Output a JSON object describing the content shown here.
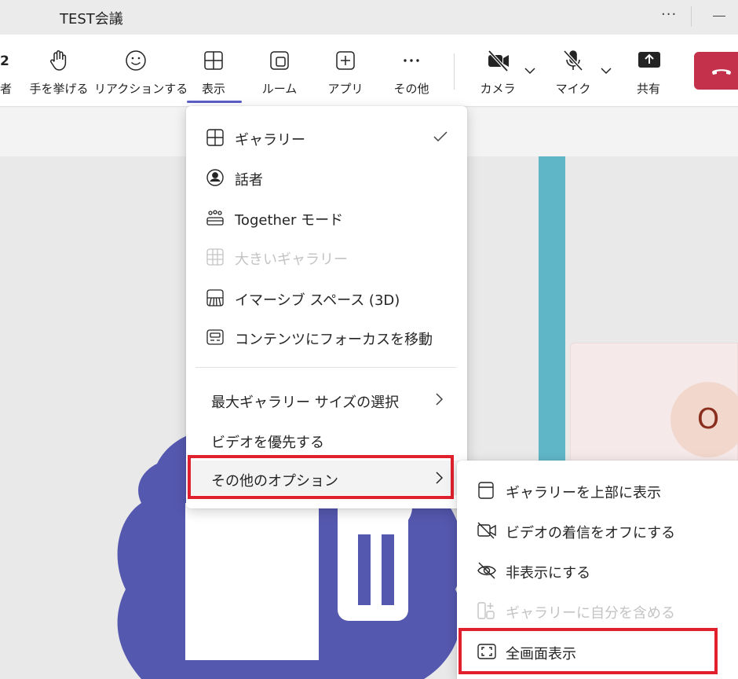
{
  "window": {
    "title": "TEST会議"
  },
  "toolbar": {
    "participants_count": "2",
    "participants_label": "者",
    "raise_hand": "手を挙げる",
    "reactions": "リアクションする",
    "view": "表示",
    "rooms": "ルーム",
    "apps": "アプリ",
    "more": "その他",
    "camera": "カメラ",
    "mic": "マイク",
    "share": "共有"
  },
  "view_menu": {
    "gallery": "ギャラリー",
    "speaker": "話者",
    "together": "Together モード",
    "large_gallery": "大きいギャラリー",
    "immersive": "イマーシブ スペース (3D)",
    "focus_content": "コンテンツにフォーカスを移動",
    "max_gallery_size": "最大ギャラリー サイズの選択",
    "prioritize_video": "ビデオを優先する",
    "more_options": "その他のオプション"
  },
  "options_submenu": {
    "gallery_on_top": "ギャラリーを上部に表示",
    "turn_off_incoming_video": "ビデオの着信をオフにする",
    "hide": "非表示にする",
    "include_self_in_gallery": "ギャラリーに自分を含める",
    "full_screen": "全画面表示"
  },
  "stage": {
    "avatar_initial": "O"
  },
  "colors": {
    "accent": "#5b5fc7",
    "leave_button": "#c4314b",
    "highlight_box": "#e0202c",
    "teams_logo": "#5558af"
  }
}
